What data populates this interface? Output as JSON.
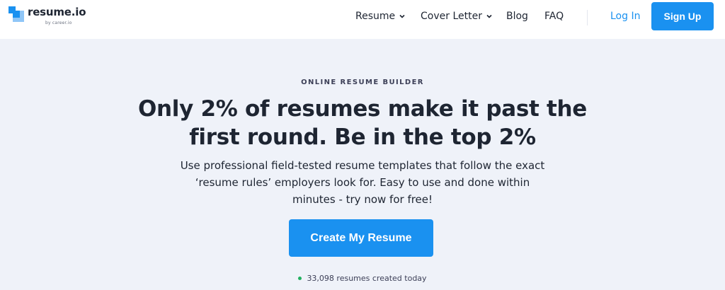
{
  "brand": {
    "name": "resume.io",
    "tagline": "by career.io",
    "accent": "#1a91f0"
  },
  "nav": {
    "items": [
      {
        "label": "Resume",
        "has_dropdown": true
      },
      {
        "label": "Cover Letter",
        "has_dropdown": true
      },
      {
        "label": "Blog",
        "has_dropdown": false
      },
      {
        "label": "FAQ",
        "has_dropdown": false
      }
    ],
    "login_label": "Log In",
    "signup_label": "Sign Up"
  },
  "hero": {
    "eyebrow": "ONLINE RESUME BUILDER",
    "headline_line1": "Only 2% of resumes make it past the",
    "headline_line2": "first round. Be in the top 2%",
    "sub_line1": "Use professional field-tested resume templates that follow the exact",
    "sub_line2": "‘resume rules’ employers look for. Easy to use and done within",
    "sub_line3": "minutes - try now for free!",
    "cta_label": "Create My Resume",
    "counter_text": "33,098 resumes created today",
    "counter_dot_color": "#21b05f"
  }
}
